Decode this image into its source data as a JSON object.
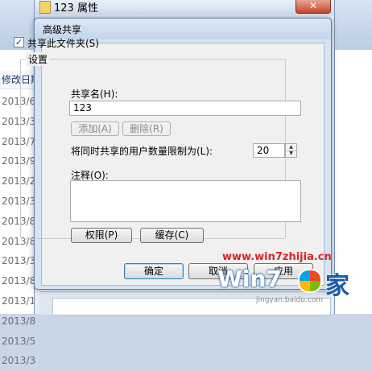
{
  "background": {
    "column_header": "修改日期",
    "dates": [
      "2013/6",
      "2013/3",
      "2013/7",
      "2013/9",
      "2013/2",
      "2013/3",
      "2013/8",
      "2013/8",
      "2013/3",
      "2013/8",
      "2013/1",
      "2013/8",
      "2013/5",
      "2013/3"
    ]
  },
  "properties_window": {
    "title": "123 属性",
    "close_glyph": "✕"
  },
  "dialog": {
    "title": "高级共享",
    "share_checkbox": {
      "label": "共享此文件夹(S)",
      "checked": true,
      "mark": "✓"
    },
    "settings_group": "设置",
    "share_name_label": "共享名(H):",
    "share_name_value": "123",
    "add_button": "添加(A)",
    "remove_button": "删除(R)",
    "user_limit_label": "将同时共享的用户数量限制为(L):",
    "user_limit_value": "20",
    "comment_label": "注释(O):",
    "permissions_button": "权限(P)",
    "caching_button": "缓存(C)",
    "ok_button": "确定",
    "cancel_button": "取消",
    "apply_button": "应用"
  },
  "watermark": {
    "url": "www.win7zhijia.cn",
    "logo": "Win7",
    "char": "家",
    "sub": "jingyan.baidu.com"
  }
}
